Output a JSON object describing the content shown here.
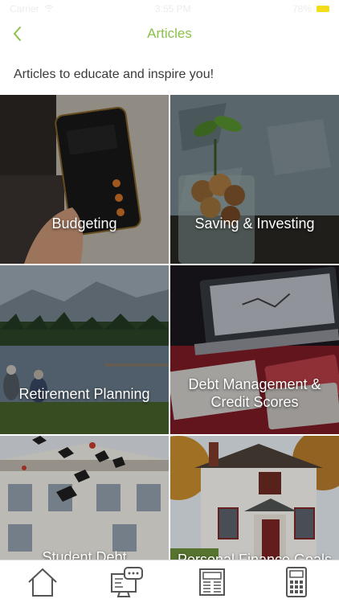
{
  "status_bar": {
    "carrier": "Carrier",
    "time": "3:55 PM",
    "battery_pct": "78%"
  },
  "nav": {
    "title": "Articles",
    "back_icon": "chevron-left-icon",
    "accent_color": "#8cc14a"
  },
  "intro": {
    "text": "Articles to educate and inspire you!"
  },
  "categories": [
    {
      "label": "Budgeting"
    },
    {
      "label": "Saving & Investing"
    },
    {
      "label": "Retirement Planning"
    },
    {
      "label": "Debt Management & Credit Scores"
    },
    {
      "label": "Student Debt"
    },
    {
      "label": "Personal Finance Goals"
    }
  ],
  "tabs": [
    {
      "icon": "home-icon"
    },
    {
      "icon": "chat-monitor-icon"
    },
    {
      "icon": "newspaper-icon"
    },
    {
      "icon": "calculator-icon"
    }
  ]
}
